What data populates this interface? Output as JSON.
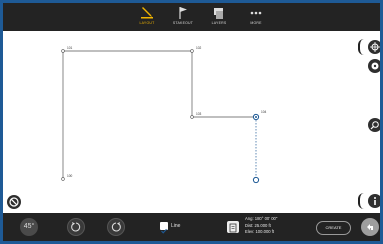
{
  "toolbar": {
    "items": [
      {
        "label": "LAYOUT",
        "icon": "survey-pencil-icon",
        "active": true
      },
      {
        "label": "STAKEOUT",
        "icon": "flag-icon",
        "active": false
      },
      {
        "label": "LAYERS",
        "icon": "layers-icon",
        "active": false
      },
      {
        "label": "MORE",
        "icon": "more-dots-icon",
        "active": false
      }
    ],
    "accent_color": "#f0b400"
  },
  "points": [
    {
      "label": "101"
    },
    {
      "label": "102"
    },
    {
      "label": "103"
    },
    {
      "label": "104"
    },
    {
      "label": "100"
    }
  ],
  "bottom": {
    "angle_label": "45°",
    "line_label": "Line",
    "line_checked": true,
    "readout": {
      "ang": "Ang: 180° 00' 00\"",
      "dist": "Dist: 25.000 ft",
      "elev": "Elev: 100.000 ft"
    },
    "create_label": "CREATE"
  },
  "colors": {
    "frame": "#1e5a96",
    "toolbar": "#232323",
    "line": "#444444",
    "selected": "#1e5a96"
  }
}
